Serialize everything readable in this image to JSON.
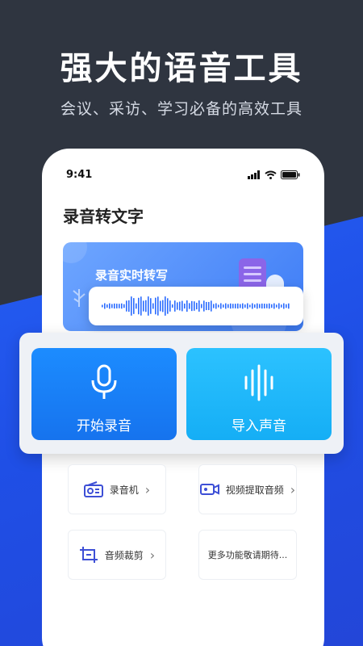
{
  "hero": {
    "title": "强大的语音工具",
    "subtitle": "会议、采访、学习必备的高效工具"
  },
  "status_bar": {
    "time": "9:41"
  },
  "app": {
    "title": "录音转文字",
    "banner_title": "录音实时转写"
  },
  "actions": {
    "record_label": "开始录音",
    "import_label": "导入声音"
  },
  "tools": [
    {
      "label": "录音机",
      "icon": "radio-icon"
    },
    {
      "label": "视频提取音频",
      "icon": "video-camera-icon"
    },
    {
      "label": "音频裁剪",
      "icon": "crop-icon"
    },
    {
      "label": "更多功能敬请期待..."
    }
  ],
  "colors": {
    "background_dark": "#2f3540",
    "background_blue": "#2a6bff",
    "record_button": "#1c8cff",
    "import_button": "#2cc2ff",
    "icon_accent": "#3d4fd6"
  }
}
